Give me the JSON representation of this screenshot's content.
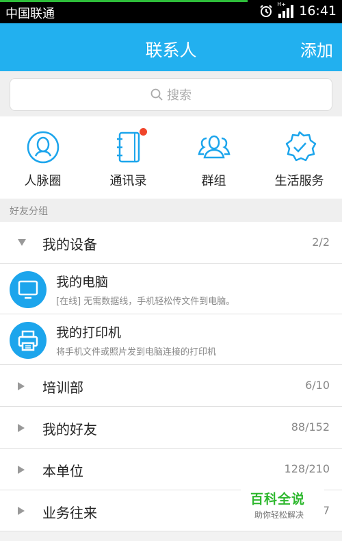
{
  "status_bar": {
    "carrier": "中国联通",
    "network": "H+",
    "time": "16:41"
  },
  "header": {
    "title": "联系人",
    "add_label": "添加"
  },
  "search": {
    "placeholder": "搜索"
  },
  "quick_actions": [
    {
      "label": "人脉圈",
      "icon": "person-circle-icon"
    },
    {
      "label": "通讯录",
      "icon": "address-book-icon",
      "badge": true
    },
    {
      "label": "群组",
      "icon": "group-icon"
    },
    {
      "label": "生活服务",
      "icon": "badge-check-icon"
    }
  ],
  "section_label": "好友分组",
  "groups": {
    "devices": {
      "name": "我的设备",
      "count": "2/2",
      "expanded": true
    },
    "training": {
      "name": "培训部",
      "count": "6/10"
    },
    "friends": {
      "name": "我的好友",
      "count": "88/152"
    },
    "unit": {
      "name": "本单位",
      "count": "128/210"
    },
    "business": {
      "name": "业务往来",
      "count": "7"
    }
  },
  "devices": [
    {
      "title": "我的电脑",
      "subtitle": "[在线] 无需数据线，手机轻松传文件到电脑。",
      "icon": "monitor-icon"
    },
    {
      "title": "我的打印机",
      "subtitle": "将手机文件或照片发到电脑连接的打印机",
      "icon": "printer-icon"
    }
  ],
  "watermark": {
    "title": "百科全说",
    "subtitle": "助你轻松解决"
  },
  "colors": {
    "accent": "#22b0ef",
    "badge": "#f0452b",
    "watermark": "#2eb82e"
  }
}
